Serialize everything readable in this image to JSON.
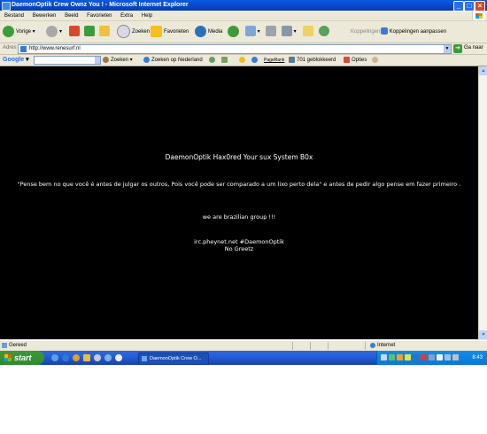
{
  "window": {
    "title": "DaemonOptik Crew Ownz You ! - Microsoft Internet Explorer",
    "minimize_glyph": "_",
    "maximize_glyph": "□",
    "close_glyph": "×"
  },
  "menu": [
    "Bestand",
    "Bewerken",
    "Beeld",
    "Favorieten",
    "Extra",
    "Help"
  ],
  "toolbar": {
    "back": "Vorige",
    "search": "Zoeken",
    "favorites": "Favorieten",
    "media": "Media",
    "links": "Koppelingen",
    "links_customize": "Koppelingen aanpassen"
  },
  "address": {
    "label": "Adres",
    "url": "http://www.renesurf.nl",
    "go": "Ga naar"
  },
  "google_toolbar": {
    "logo": "Google",
    "search": "Zoeken",
    "search_nl": "Zoeken op Nederland",
    "pagerank": "PageRank",
    "blocked": "701 geblokkeerd",
    "options": "Opties"
  },
  "page": {
    "heading": "DaemonOptik Hax0red Your sux System B0x",
    "quote": "\"Pense bem no que você é antes de julgar os outros, Pois você pode ser comparado a um lixo perto dela\" e antes de pedir algo pense em fazer primeiro .",
    "brazil": "we are brazilian group !!!",
    "irc": "irc.pheynet.net #DaemonOptik",
    "greetz": "No Greetz"
  },
  "status": {
    "text": "Gereed",
    "zone": "Internet"
  },
  "taskbar": {
    "start": "start",
    "task": "DaemonOptik Crew O...",
    "clock": "8:43"
  }
}
